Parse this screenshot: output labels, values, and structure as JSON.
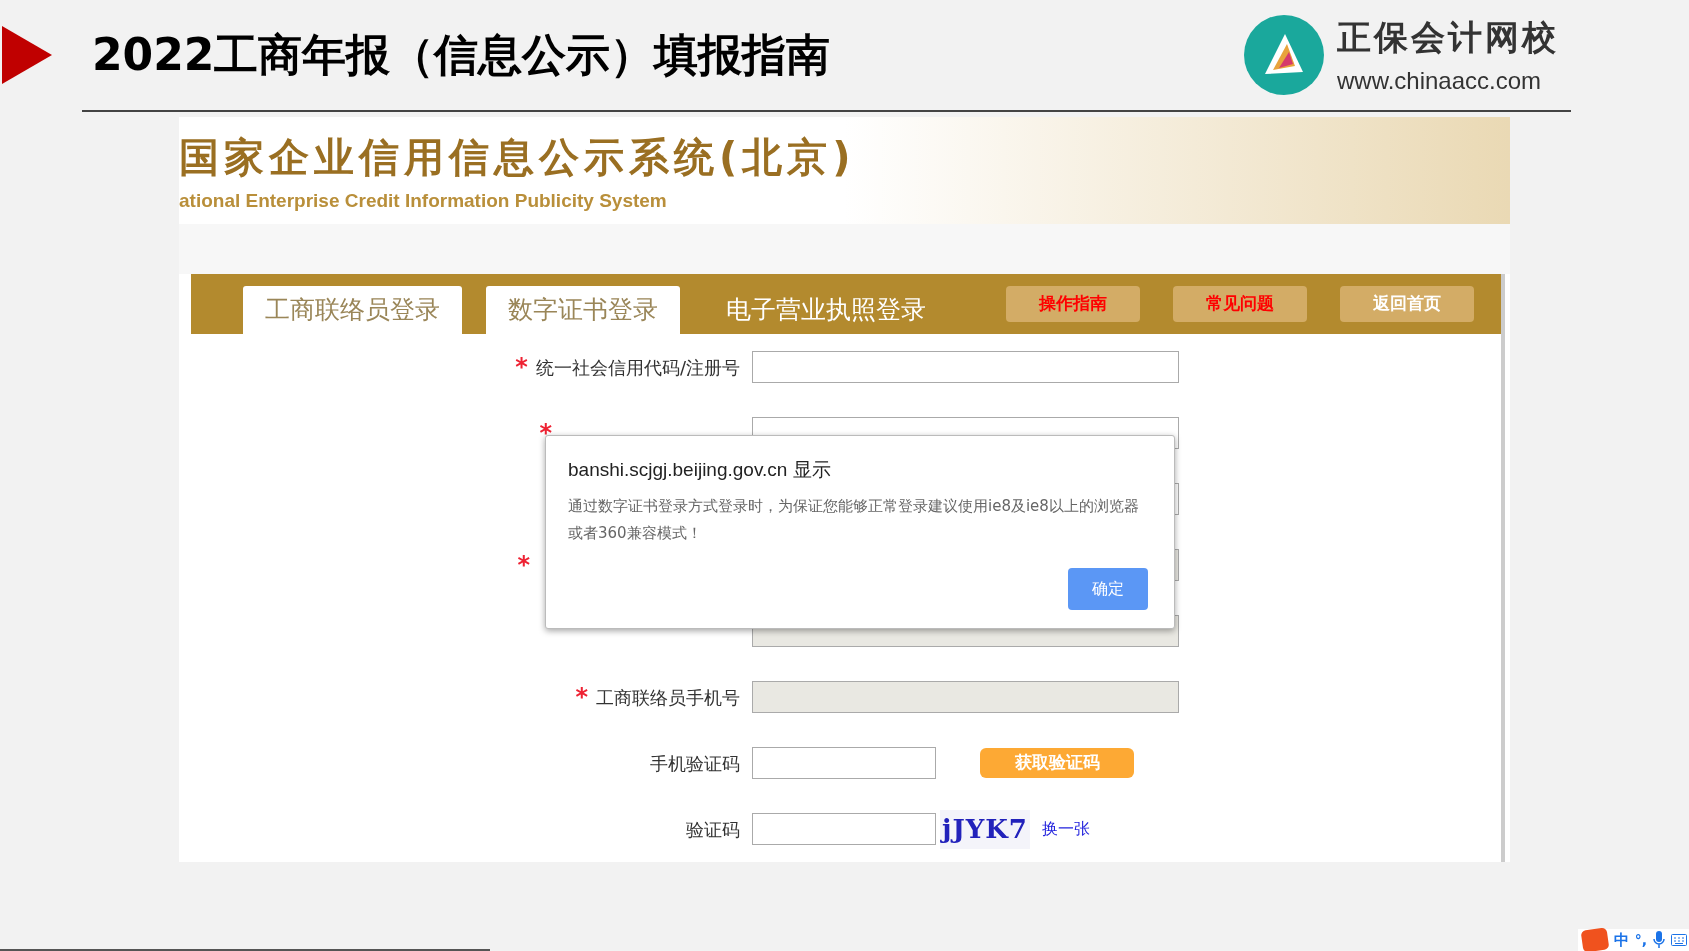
{
  "slide": {
    "title": "2022工商年报（信息公示）填报指南",
    "logo": {
      "name": "正保会计网校",
      "url": "www.chinaacc.com"
    }
  },
  "site": {
    "title": "国家企业信用信息公示系统(北京)",
    "subtitle": "ational Enterprise Credit Information Publicity System"
  },
  "tabs": [
    {
      "label": "工商联络员登录",
      "selected": false
    },
    {
      "label": "数字证书登录",
      "selected": false
    },
    {
      "label": "电子营业执照登录",
      "selected": true
    }
  ],
  "nav_buttons": [
    "操作指南",
    "常见问题",
    "返回首页"
  ],
  "form": [
    {
      "kind": "text",
      "label": "统一社会信用代码/注册号",
      "marker": "*",
      "disabled": false
    },
    {
      "kind": "text",
      "marker": "*",
      "disabled": false
    },
    {
      "kind": "text",
      "disabled": false
    },
    {
      "kind": "text",
      "marker": "*",
      "disabled": true
    },
    {
      "kind": "text",
      "disabled": true
    },
    {
      "kind": "text",
      "label": "工商联络员手机号",
      "marker": "*",
      "disabled": true
    },
    {
      "kind": "sms",
      "label": "手机验证码",
      "disabled": false,
      "button": "获取验证码"
    },
    {
      "kind": "captcha",
      "label": "验证码",
      "disabled": false,
      "captcha": "jJYK7",
      "refresh": "换一张"
    }
  ],
  "dialog": {
    "title": "banshi.scjgj.beijing.gov.cn 显示",
    "message": "通过数字证书登录方式登录时，为保证您能够正常登录建议使用ie8及ie8以上的浏览器或者360兼容模式！",
    "button": "确定"
  },
  "ime": {
    "mode": "中",
    "punct": "°,"
  }
}
